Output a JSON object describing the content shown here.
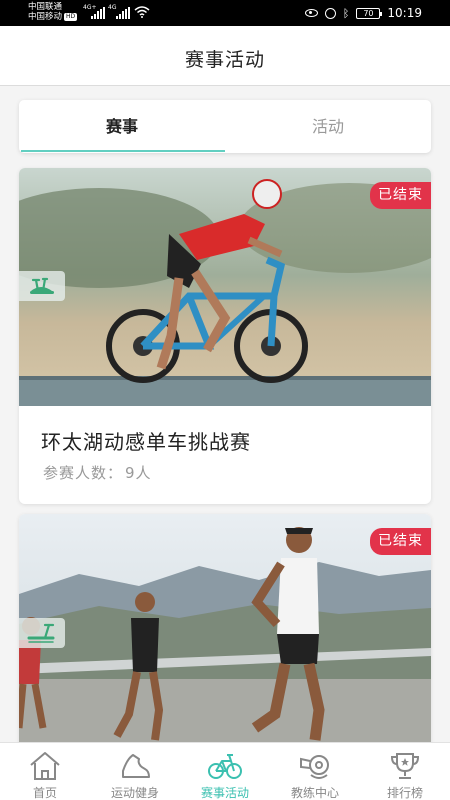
{
  "status_bar": {
    "carrier_1": "中国联通",
    "carrier_2": "中国移动",
    "hd": "HD",
    "net_1": "4G+",
    "net_2": "4G",
    "battery": "70",
    "time": "10:19"
  },
  "header": {
    "title": "赛事活动"
  },
  "tabs": [
    {
      "label": "赛事",
      "selected": true
    },
    {
      "label": "活动",
      "selected": false
    }
  ],
  "cards": [
    {
      "status": "已结束",
      "type_icon": "exercise-bike-icon",
      "title": "环太湖动感单车挑战赛",
      "participants_label": "参赛人数：",
      "participants_value": "9人"
    },
    {
      "status": "已结束",
      "type_icon": "treadmill-icon"
    }
  ],
  "bottom_nav": [
    {
      "label": "首页",
      "icon": "home-icon",
      "active": false
    },
    {
      "label": "运动健身",
      "icon": "sneaker-icon",
      "active": false
    },
    {
      "label": "赛事活动",
      "icon": "bicycle-icon",
      "active": true
    },
    {
      "label": "教练中心",
      "icon": "coach-whistle-icon",
      "active": false
    },
    {
      "label": "排行榜",
      "icon": "trophy-icon",
      "active": false
    }
  ],
  "colors": {
    "accent": "#62cfc1",
    "badge": "#e2334a",
    "active_nav": "#3bc0b0"
  }
}
